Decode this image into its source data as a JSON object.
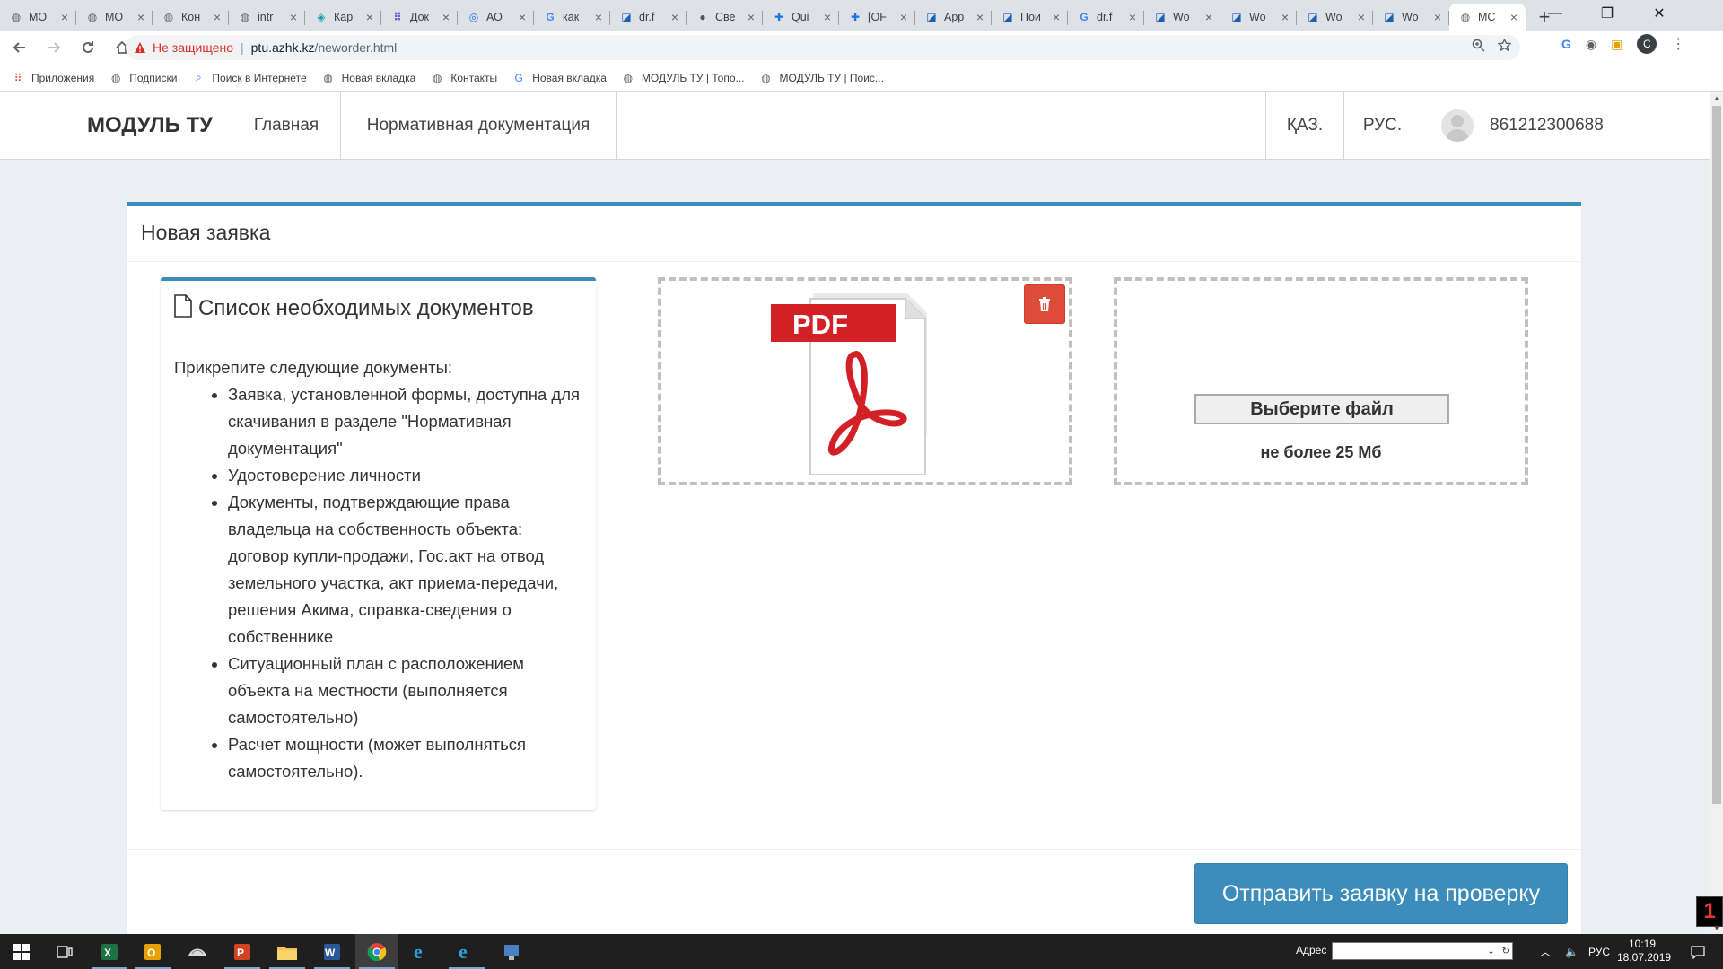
{
  "browser": {
    "tabs": [
      {
        "title": "МО",
        "icon": "globe"
      },
      {
        "title": "МО",
        "icon": "globe"
      },
      {
        "title": "Кон",
        "icon": "globe"
      },
      {
        "title": "intr",
        "icon": "globe"
      },
      {
        "title": "Кар",
        "icon": "map"
      },
      {
        "title": "Док",
        "icon": "grid"
      },
      {
        "title": "АО",
        "icon": "circle"
      },
      {
        "title": "как",
        "icon": "google"
      },
      {
        "title": "dr.f",
        "icon": "doc"
      },
      {
        "title": "Све",
        "icon": "apple"
      },
      {
        "title": "Qui",
        "icon": "plus"
      },
      {
        "title": "[OF",
        "icon": "plus"
      },
      {
        "title": "App",
        "icon": "doc"
      },
      {
        "title": "Пои",
        "icon": "doc"
      },
      {
        "title": "dr.f",
        "icon": "google"
      },
      {
        "title": "Wo",
        "icon": "doc"
      },
      {
        "title": "Wo",
        "icon": "doc"
      },
      {
        "title": "Wo",
        "icon": "doc"
      },
      {
        "title": "Wo",
        "icon": "doc"
      },
      {
        "title": "МС",
        "icon": "globe",
        "active": true
      }
    ],
    "new_tab_label": "+",
    "window_controls": {
      "minimize": "—",
      "maximize": "❐",
      "close": "✕"
    },
    "address": {
      "security_label": "Не защищено",
      "host": "ptu.azhk.kz",
      "path": "/neworder.html"
    },
    "profile_initial": "C",
    "bookmarks": [
      {
        "label": "Приложения",
        "icon": "apps-grid"
      },
      {
        "label": "Подписки",
        "icon": "globe"
      },
      {
        "label": "Поиск в Интернете",
        "icon": "search"
      },
      {
        "label": "Новая вкладка",
        "icon": "globe"
      },
      {
        "label": "Контакты",
        "icon": "globe"
      },
      {
        "label": "Новая вкладка",
        "icon": "google"
      },
      {
        "label": "МОДУЛЬ ТУ | Топо...",
        "icon": "globe"
      },
      {
        "label": "МОДУЛЬ ТУ | Поис...",
        "icon": "globe"
      }
    ]
  },
  "site": {
    "brand": "МОДУЛЬ ТУ",
    "nav": {
      "home": "Главная",
      "docs": "Нормативная документация"
    },
    "lang": {
      "kz": "ҚАЗ.",
      "ru": "РУС."
    },
    "user": "861212300688"
  },
  "main": {
    "title": "Новая заявка",
    "docs_panel": {
      "title": "Список необходимых документов",
      "intro": "Прикрепите следующие документы:",
      "items": [
        "Заявка, установленной формы, доступна для скачивания в разделе \"Нормативная документация\"",
        "Удостоверение личности",
        "Документы, подтверждающие права владельца на собственность объекта: договор купли-продажи, Гос.акт на отвод земельного участка, акт приема-передачи, решения Акима, справка-сведения о собственнике",
        "Ситуационный план с расположением объекта на местности (выполняется самостоятельно)",
        "Расчет мощности (может выполняться самостоятельно)."
      ]
    },
    "upload": {
      "pdf_label": "PDF",
      "choose_label": "Выберите файл",
      "max_size": "не более 25 Мб"
    },
    "submit_label": "Отправить заявку на проверку"
  },
  "taskbar": {
    "address_label": "Адрес",
    "lang": "РУС",
    "time": "10:19",
    "date": "18.07.2019"
  },
  "overlay_badge": "1",
  "colors": {
    "primary": "#3c8dbc",
    "danger": "#dd4b39",
    "page_bg": "#ecf0f5",
    "pdf_red": "#d32027"
  }
}
